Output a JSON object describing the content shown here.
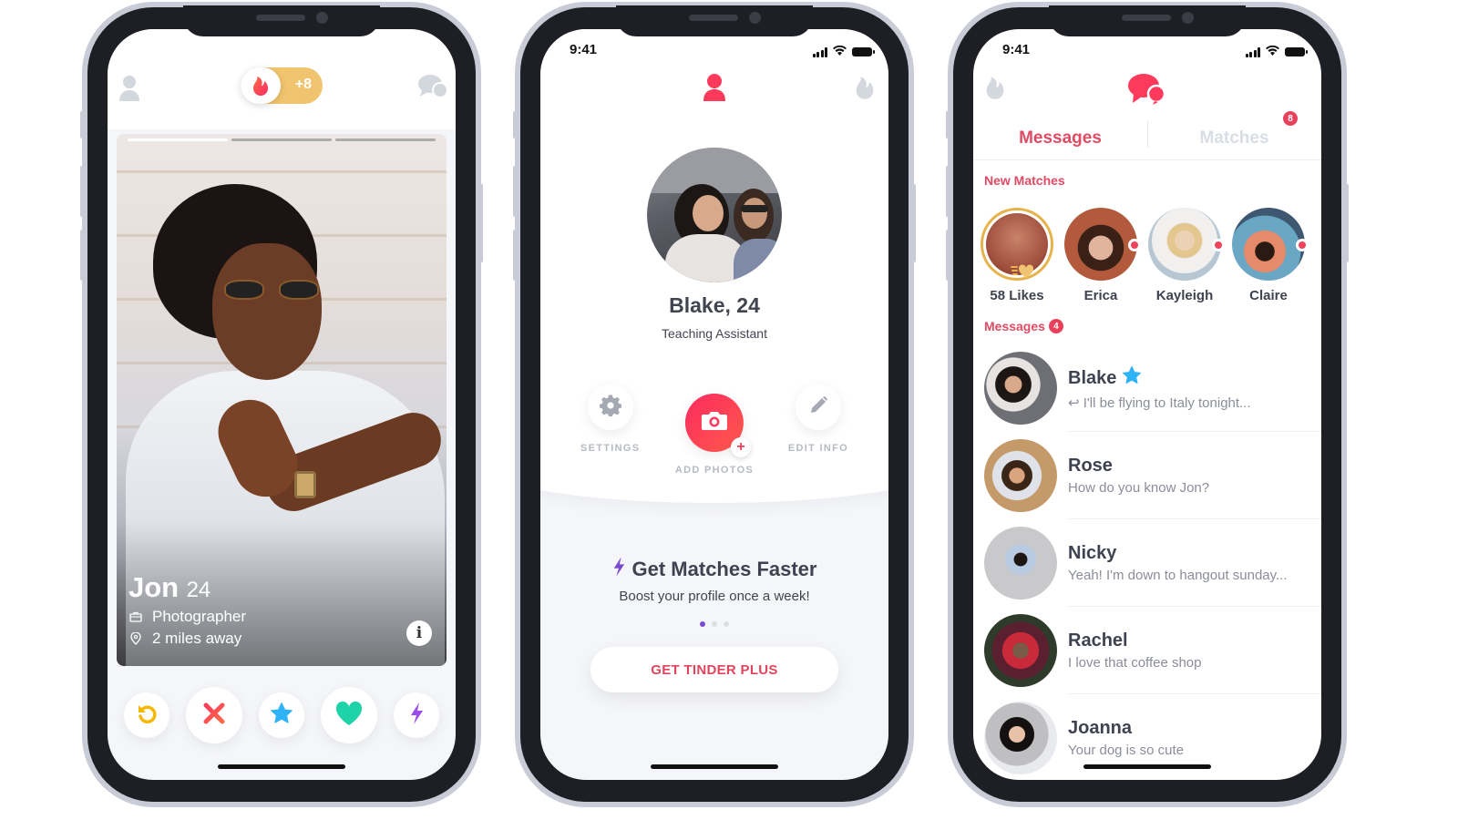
{
  "colors": {
    "brand": "#fd3a5c",
    "gold": "#f0c470",
    "superlike": "#2db3f6",
    "like": "#1fd3a8",
    "rewind": "#f5b800",
    "boost": "#9a4ded",
    "frame": "#1d1f25",
    "muted": "#d3d7de"
  },
  "phone1": {
    "header": {
      "left_icon": "profile-icon",
      "toggle_icon": "tinder-flame-icon",
      "toggle_count": "+8",
      "right_icon": "messages-icon"
    },
    "card": {
      "photo_count": 3,
      "active_photo": 1,
      "name": "Jon",
      "age": "24",
      "job": "Photographer",
      "job_icon": "briefcase-icon",
      "distance": "2 miles away",
      "distance_icon": "location-pin-icon",
      "info_label": "i"
    },
    "actions": [
      {
        "name": "rewind",
        "icon": "rewind-icon"
      },
      {
        "name": "nope",
        "icon": "close-icon"
      },
      {
        "name": "super-like",
        "icon": "star-icon"
      },
      {
        "name": "like",
        "icon": "heart-icon"
      },
      {
        "name": "boost",
        "icon": "lightning-icon"
      }
    ]
  },
  "phone2": {
    "status_time": "9:41",
    "header": {
      "center_icon": "profile-icon",
      "right_icon": "tinder-flame-icon"
    },
    "profile": {
      "name": "Blake, 24",
      "job": "Teaching Assistant"
    },
    "buttons": {
      "settings": "SETTINGS",
      "add_photos": "ADD PHOTOS",
      "add_plus": "+",
      "edit_info": "EDIT INFO"
    },
    "promo": {
      "title": "Get Matches Faster",
      "subtitle": "Boost your profile once a week!",
      "page_count": 3,
      "active_page": 1
    },
    "cta": "GET TINDER PLUS"
  },
  "phone3": {
    "status_time": "9:41",
    "header": {
      "left_icon": "tinder-flame-icon",
      "center_icon": "messages-icon"
    },
    "tabs": {
      "messages": "Messages",
      "matches": "Matches",
      "matches_badge": "8"
    },
    "new_matches_label": "New Matches",
    "new_matches": [
      {
        "name": "58 Likes",
        "type": "likes"
      },
      {
        "name": "Erica",
        "unread": true
      },
      {
        "name": "Kayleigh",
        "unread": true
      },
      {
        "name": "Claire",
        "unread": true
      }
    ],
    "messages_label": "Messages",
    "messages_badge": "4",
    "messages": [
      {
        "name": "Blake",
        "preview": "I'll be flying to Italy tonight...",
        "super_like": true,
        "replied": true
      },
      {
        "name": "Rose",
        "preview": "How do you know Jon?"
      },
      {
        "name": "Nicky",
        "preview": "Yeah! I'm down to hangout sunday..."
      },
      {
        "name": "Rachel",
        "preview": "I love that coffee shop"
      },
      {
        "name": "Joanna",
        "preview": "Your dog is so cute"
      }
    ]
  }
}
